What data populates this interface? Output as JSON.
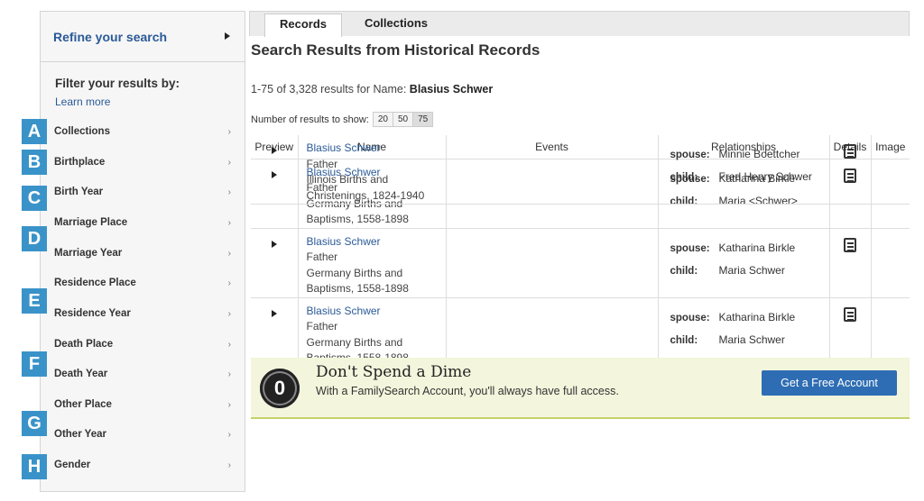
{
  "sidebar": {
    "refine_label": "Refine your search",
    "filter_title": "Filter your results by:",
    "learn_more": "Learn more",
    "items": [
      {
        "label": "Collections"
      },
      {
        "label": "Birthplace"
      },
      {
        "label": "Birth Year"
      },
      {
        "label": "Marriage Place"
      },
      {
        "label": "Marriage Year"
      },
      {
        "label": "Residence Place"
      },
      {
        "label": "Residence Year"
      },
      {
        "label": "Death Place"
      },
      {
        "label": "Death Year"
      },
      {
        "label": "Other Place"
      },
      {
        "label": "Other Year"
      },
      {
        "label": "Gender"
      }
    ],
    "chevron": "›"
  },
  "badges": [
    "A",
    "B",
    "C",
    "D",
    "E",
    "F",
    "G",
    "H"
  ],
  "tabs": {
    "records": "Records",
    "collections": "Collections"
  },
  "page_title": "Search Results from Historical Records",
  "results": {
    "count_prefix": "1-75 of 3,328 results for Name:",
    "query_name": "Blasius Schwer",
    "show_label": "Number of results to show:",
    "show_options": [
      "20",
      "50",
      "75"
    ]
  },
  "table": {
    "headers": [
      "Preview",
      "Name",
      "Events",
      "Relationships",
      "Details",
      "Image"
    ],
    "rows": [
      {
        "name": "Blasius Schwer",
        "role": "Father",
        "collection_1": "Germany Births and",
        "collection_2": "Baptisms, 1558-1898",
        "spouse_label": "spouse:",
        "spouse": "Katharina Birkle",
        "child_label": "child:",
        "child": "Maria <Schwer>"
      },
      {
        "name": "Blasius Schwer",
        "role": "Father",
        "collection_1": "Germany Births and",
        "collection_2": "Baptisms, 1558-1898",
        "spouse_label": "spouse:",
        "spouse": "Katharina Birkle",
        "child_label": "child:",
        "child": "Maria Schwer"
      },
      {
        "name": "Blasius Schwer",
        "role": "Father",
        "collection_1": "Germany Births and",
        "collection_2": "Baptisms, 1558-1898",
        "spouse_label": "spouse:",
        "spouse": "Katharina Birkle",
        "child_label": "child:",
        "child": "Maria Schwer"
      },
      {
        "name": "Blasius Schwer",
        "role": "Father",
        "collection_1": "Illinois Births and",
        "collection_2": "Christenings, 1824-1940",
        "spouse_label": "spouse:",
        "spouse": "Minnie Boettcher",
        "child_label": "child:",
        "child": "Fred Henry Schwer"
      }
    ]
  },
  "promo": {
    "coin": "0",
    "title": "Don't Spend a Dime",
    "text": "With a FamilySearch Account, you'll always have full access.",
    "button": "Get a Free Account"
  },
  "colors": {
    "accent": "#2a5a97",
    "badge": "#3a93c8",
    "button": "#2e6db3",
    "promo_bg": "#f3f5dc"
  }
}
